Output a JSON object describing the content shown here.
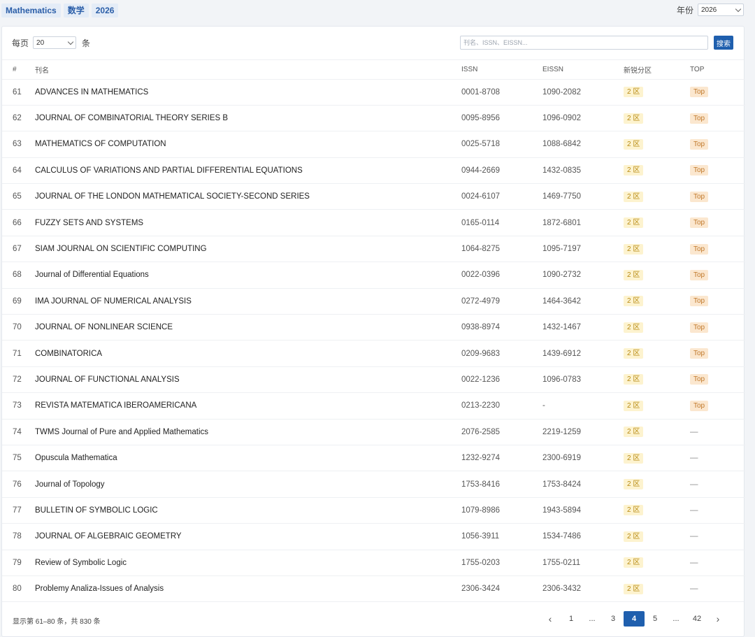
{
  "tags": [
    "Mathematics",
    "数学",
    "2026"
  ],
  "year_filter": {
    "label": "年份",
    "value": "2026"
  },
  "toolbar": {
    "per_page_prefix": "每页",
    "per_page_value": "20",
    "per_page_suffix": "条",
    "search_placeholder": "刊名、ISSN、EISSN...",
    "search_button": "搜索"
  },
  "table": {
    "headers": {
      "num": "#",
      "title": "刊名",
      "issn": "ISSN",
      "eissn": "EISSN",
      "zone": "新锐分区",
      "top": "TOP"
    },
    "rows": [
      {
        "num": "61",
        "title": "ADVANCES IN MATHEMATICS",
        "issn": "0001-8708",
        "eissn": "1090-2082",
        "zone": "2 区",
        "top": "Top"
      },
      {
        "num": "62",
        "title": "JOURNAL OF COMBINATORIAL THEORY SERIES B",
        "issn": "0095-8956",
        "eissn": "1096-0902",
        "zone": "2 区",
        "top": "Top"
      },
      {
        "num": "63",
        "title": "MATHEMATICS OF COMPUTATION",
        "issn": "0025-5718",
        "eissn": "1088-6842",
        "zone": "2 区",
        "top": "Top"
      },
      {
        "num": "64",
        "title": "CALCULUS OF VARIATIONS AND PARTIAL DIFFERENTIAL EQUATIONS",
        "issn": "0944-2669",
        "eissn": "1432-0835",
        "zone": "2 区",
        "top": "Top"
      },
      {
        "num": "65",
        "title": "JOURNAL OF THE LONDON MATHEMATICAL SOCIETY-SECOND SERIES",
        "issn": "0024-6107",
        "eissn": "1469-7750",
        "zone": "2 区",
        "top": "Top"
      },
      {
        "num": "66",
        "title": "FUZZY SETS AND SYSTEMS",
        "issn": "0165-0114",
        "eissn": "1872-6801",
        "zone": "2 区",
        "top": "Top"
      },
      {
        "num": "67",
        "title": "SIAM JOURNAL ON SCIENTIFIC COMPUTING",
        "issn": "1064-8275",
        "eissn": "1095-7197",
        "zone": "2 区",
        "top": "Top"
      },
      {
        "num": "68",
        "title": "Journal of Differential Equations",
        "issn": "0022-0396",
        "eissn": "1090-2732",
        "zone": "2 区",
        "top": "Top"
      },
      {
        "num": "69",
        "title": "IMA JOURNAL OF NUMERICAL ANALYSIS",
        "issn": "0272-4979",
        "eissn": "1464-3642",
        "zone": "2 区",
        "top": "Top"
      },
      {
        "num": "70",
        "title": "JOURNAL OF NONLINEAR SCIENCE",
        "issn": "0938-8974",
        "eissn": "1432-1467",
        "zone": "2 区",
        "top": "Top"
      },
      {
        "num": "71",
        "title": "COMBINATORICA",
        "issn": "0209-9683",
        "eissn": "1439-6912",
        "zone": "2 区",
        "top": "Top"
      },
      {
        "num": "72",
        "title": "JOURNAL OF FUNCTIONAL ANALYSIS",
        "issn": "0022-1236",
        "eissn": "1096-0783",
        "zone": "2 区",
        "top": "Top"
      },
      {
        "num": "73",
        "title": "REVISTA MATEMATICA IBEROAMERICANA",
        "issn": "0213-2230",
        "eissn": "-",
        "zone": "2 区",
        "top": "Top"
      },
      {
        "num": "74",
        "title": "TWMS Journal of Pure and Applied Mathematics",
        "issn": "2076-2585",
        "eissn": "2219-1259",
        "zone": "2 区",
        "top": "—"
      },
      {
        "num": "75",
        "title": "Opuscula Mathematica",
        "issn": "1232-9274",
        "eissn": "2300-6919",
        "zone": "2 区",
        "top": "—"
      },
      {
        "num": "76",
        "title": "Journal of Topology",
        "issn": "1753-8416",
        "eissn": "1753-8424",
        "zone": "2 区",
        "top": "—"
      },
      {
        "num": "77",
        "title": "BULLETIN OF SYMBOLIC LOGIC",
        "issn": "1079-8986",
        "eissn": "1943-5894",
        "zone": "2 区",
        "top": "—"
      },
      {
        "num": "78",
        "title": "JOURNAL OF ALGEBRAIC GEOMETRY",
        "issn": "1056-3911",
        "eissn": "1534-7486",
        "zone": "2 区",
        "top": "—"
      },
      {
        "num": "79",
        "title": "Review of Symbolic Logic",
        "issn": "1755-0203",
        "eissn": "1755-0211",
        "zone": "2 区",
        "top": "—"
      },
      {
        "num": "80",
        "title": "Problemy Analiza-Issues of Analysis",
        "issn": "2306-3424",
        "eissn": "2306-3432",
        "zone": "2 区",
        "top": "—"
      }
    ]
  },
  "footer": {
    "summary": "显示第 61–80 条，共 830 条",
    "pages": [
      "1",
      "...",
      "3",
      "4",
      "5",
      "...",
      "42"
    ],
    "active_page": "4"
  },
  "icons": {
    "prev": "chevron-left-icon",
    "next": "chevron-right-icon",
    "dropdown": "chevron-down-icon"
  }
}
